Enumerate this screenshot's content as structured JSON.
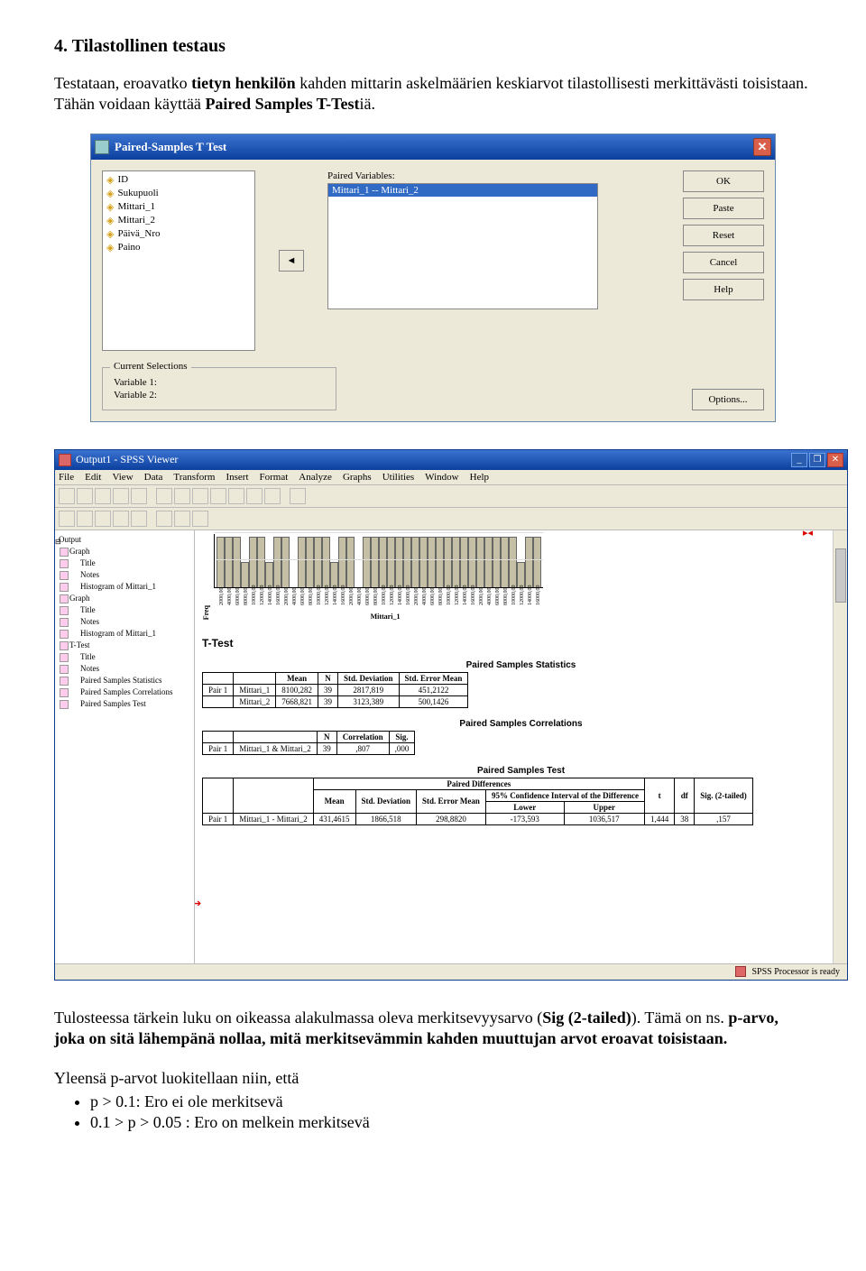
{
  "doc": {
    "heading": "4. Tilastollinen testaus",
    "intro_pre": "Testataan, eroavatko ",
    "intro_b1": "tietyn henkilön",
    "intro_mid": " kahden mittarin askelmäärien keskiarvot tilastollisesti merkittävästi toisistaan. Tähän voidaan käyttää ",
    "intro_b2": "Paired Samples T-Test",
    "intro_post": "iä.",
    "after_pre": "Tulosteessa tärkein luku on oikeassa alakulmassa oleva merkitsevyysarvo (",
    "after_b1": "Sig (2-tailed)",
    "after_mid": "). Tämä on ns. ",
    "after_b2": "p-arvo, joka on sitä lähempänä nollaa, mitä merkitsevämmin kahden muuttujan arvot eroavat toisistaan.",
    "after_post": "",
    "p3": "Yleensä p-arvot luokitellaan niin, että",
    "bullets": [
      "p > 0.1: Ero ei ole merkitsevä",
      "0.1 > p > 0.05 : Ero on melkein merkitsevä"
    ]
  },
  "dialog": {
    "title": "Paired-Samples T Test",
    "vars": [
      "ID",
      "Sukupuoli",
      "Mittari_1",
      "Mittari_2",
      "Päivä_Nro",
      "Paino"
    ],
    "paired_label": "Paired Variables:",
    "paired_selected": "Mittari_1 -- Mittari_2",
    "move_glyph": "◄",
    "buttons": {
      "ok": "OK",
      "paste": "Paste",
      "reset": "Reset",
      "cancel": "Cancel",
      "help": "Help"
    },
    "cursel": {
      "legend": "Current Selections",
      "v1": "Variable 1:",
      "v2": "Variable 2:"
    },
    "options": "Options..."
  },
  "chart_data": {
    "type": "bar",
    "title": "",
    "xlabel": "Mittari_1",
    "ylabel": "Freq",
    "ylim": [
      0,
      2
    ],
    "categories": [
      "2000,00",
      "4000,00",
      "6000,00",
      "8000,00",
      "10000,00",
      "12000,00",
      "14000,00",
      "16000,00",
      "2000,00",
      "4000,00",
      "6000,00",
      "8000,00",
      "10000,00",
      "12000,00",
      "14000,00",
      "16000,00",
      "2000,00",
      "4000,00",
      "6000,00",
      "8000,00",
      "10000,00",
      "12000,00",
      "14000,00",
      "16000,00",
      "2000,00",
      "4000,00",
      "6000,00",
      "8000,00",
      "10000,00",
      "12000,00",
      "14000,00",
      "16000,00",
      "2000,00",
      "4000,00",
      "6000,00",
      "8000,00",
      "10000,00",
      "12000,00",
      "14000,00",
      "16000,00"
    ],
    "values": [
      2,
      2,
      2,
      1,
      2,
      2,
      1,
      2,
      2,
      0,
      2,
      2,
      2,
      2,
      1,
      2,
      2,
      0,
      2,
      2,
      2,
      2,
      2,
      2,
      2,
      2,
      2,
      2,
      2,
      2,
      2,
      2,
      2,
      2,
      2,
      2,
      2,
      1,
      2,
      2
    ]
  },
  "viewer": {
    "title": "Output1 - SPSS Viewer",
    "menu": [
      "File",
      "Edit",
      "View",
      "Data",
      "Transform",
      "Insert",
      "Format",
      "Analyze",
      "Graphs",
      "Utilities",
      "Window",
      "Help"
    ],
    "tree": [
      "Output",
      " Graph",
      "  Title",
      "  Notes",
      "  Histogram of Mittari_1",
      " Graph",
      "  Title",
      "  Notes",
      "  Histogram of Mittari_1",
      " T-Test",
      "  Title",
      "  Notes",
      "  Paired Samples Statistics",
      "  Paired Samples Correlations",
      "  Paired Samples Test"
    ],
    "ttest_heading": "T-Test",
    "t1": {
      "title": "Paired Samples Statistics",
      "cols": [
        "",
        "",
        "Mean",
        "N",
        "Std. Deviation",
        "Std. Error Mean"
      ],
      "rows": [
        [
          "Pair 1",
          "Mittari_1",
          "8100,282",
          "39",
          "2817,819",
          "451,2122"
        ],
        [
          "",
          "Mittari_2",
          "7668,821",
          "39",
          "3123,389",
          "500,1426"
        ]
      ]
    },
    "t2": {
      "title": "Paired Samples Correlations",
      "cols": [
        "",
        "",
        "N",
        "Correlation",
        "Sig."
      ],
      "rows": [
        [
          "Pair 1",
          "Mittari_1 & Mittari_2",
          "39",
          ",807",
          ",000"
        ]
      ]
    },
    "t3": {
      "title": "Paired Samples Test",
      "group": "Paired Differences",
      "sub": "95% Confidence Interval of the Difference",
      "cols": [
        "",
        "",
        "Mean",
        "Std. Deviation",
        "Std. Error Mean",
        "Lower",
        "Upper",
        "t",
        "df",
        "Sig. (2-tailed)"
      ],
      "rows": [
        [
          "Pair 1",
          "Mittari_1 - Mittari_2",
          "431,4615",
          "1866,518",
          "298,8820",
          "-173,593",
          "1036,517",
          "1,444",
          "38",
          ",157"
        ]
      ]
    },
    "status": "SPSS Processor is ready",
    "wctrl": {
      "min": "_",
      "max": "❐",
      "close": "✕"
    }
  }
}
